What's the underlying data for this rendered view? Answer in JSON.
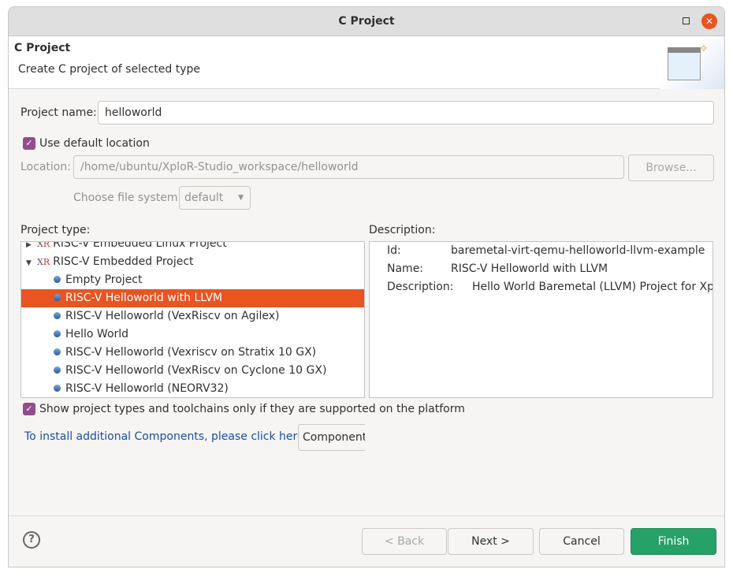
{
  "window": {
    "title": "C Project"
  },
  "header": {
    "title": "C Project",
    "subtitle": "Create C project of selected type"
  },
  "form": {
    "project_name_label": "Project name:",
    "project_name_value": "helloworld",
    "use_default_location_label": "Use default location",
    "use_default_location_checked": true,
    "location_label": "Location:",
    "location_value": "/home/ubuntu/XploR-Studio_workspace/helloworld",
    "browse_label": "Browse...",
    "file_system_label": "Choose file system:",
    "file_system_value": "default"
  },
  "project_type": {
    "label": "Project type:",
    "items": [
      {
        "label": "RISC-V Embedded Linux Project",
        "level": 0,
        "expanded": false
      },
      {
        "label": "RISC-V Embedded Project",
        "level": 0,
        "expanded": true
      },
      {
        "label": "Empty Project",
        "level": 1
      },
      {
        "label": "RISC-V Helloworld with LLVM",
        "level": 1,
        "selected": true
      },
      {
        "label": "RISC-V Helloworld (VexRiscv on Agilex)",
        "level": 1
      },
      {
        "label": "Hello World",
        "level": 1
      },
      {
        "label": "RISC-V Helloworld (Vexriscv on Stratix 10 GX)",
        "level": 1
      },
      {
        "label": "RISC-V Helloworld (VexRiscv on Cyclone 10 GX)",
        "level": 1
      },
      {
        "label": "RISC-V Helloworld (NEORV32)",
        "level": 1
      }
    ],
    "icon_logo": "XR"
  },
  "description": {
    "label": "Description:",
    "id_label": "Id:",
    "id_value": "baremetal-virt-qemu-helloworld-llvm-example",
    "name_label": "Name:",
    "name_value": "RISC-V Helloworld with LLVM",
    "desc_label": "Description:",
    "desc_value": "Hello World Baremetal (LLVM) Project for XploR"
  },
  "show_supported_label": "Show project types and toolchains only if they are supported on the platform",
  "install_text": "To install additional Components, please click here:",
  "components_button": "Components",
  "footer": {
    "back": "< Back",
    "next": "Next >",
    "cancel": "Cancel",
    "finish": "Finish"
  },
  "colors": {
    "selection": "#e95420",
    "finish": "#26a269",
    "checkbox": "#924d8b"
  }
}
